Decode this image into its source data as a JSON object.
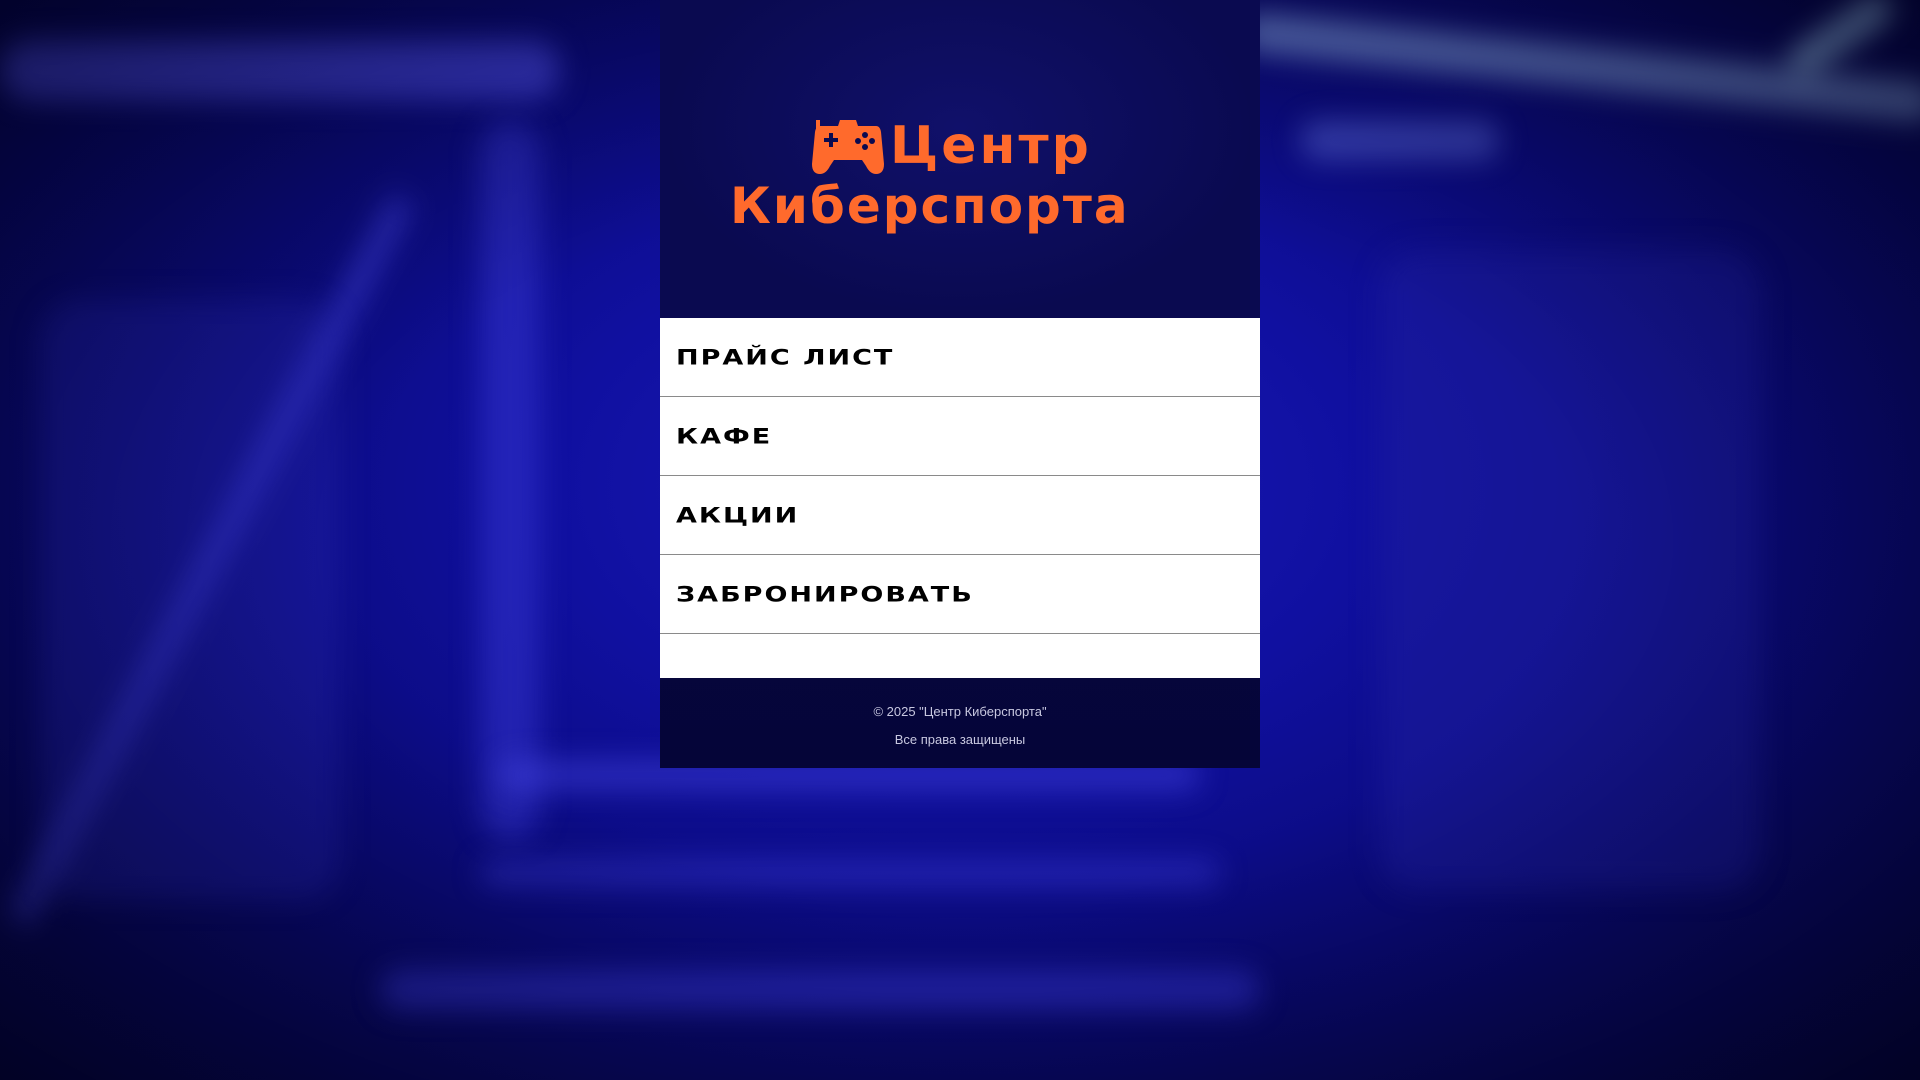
{
  "logo": {
    "line1": "Центр",
    "line2": "Киберспорта",
    "icon": "gamepad-icon",
    "color": "#ff6a2c"
  },
  "menu": {
    "items": [
      {
        "label": "Прайс лист"
      },
      {
        "label": "Кафе"
      },
      {
        "label": "Акции"
      },
      {
        "label": "Забронировать"
      }
    ]
  },
  "footer": {
    "copyright": "© 2025 \"Центр Киберспорта\"",
    "rights": "Все права защищены"
  }
}
